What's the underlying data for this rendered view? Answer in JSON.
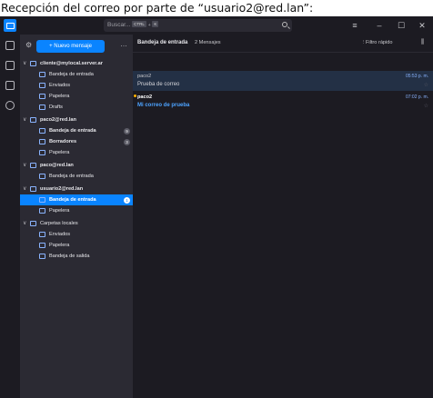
{
  "caption": "Recepción del correo por parte de “usuario2@red.lan”:",
  "titlebar": {
    "search_placeholder": "Buscar...",
    "search_kbd_1": "CTRL",
    "search_kbd_plus": "+",
    "search_kbd_2": "K",
    "menu_glyph": "≡",
    "min_glyph": "–",
    "max_glyph": "☐",
    "close_glyph": "✕"
  },
  "pane": {
    "new_message": "+ Nuevo mensaje",
    "more": "…"
  },
  "folders": [
    {
      "label": "cliente@mylocal.server.ar",
      "level": 0,
      "chevron": "∨",
      "bold": true,
      "icon": "account-icon"
    },
    {
      "label": "Bandeja de entrada",
      "level": 1,
      "icon": "inbox-icon"
    },
    {
      "label": "Enviados",
      "level": 1,
      "icon": "sent-icon"
    },
    {
      "label": "Papelera",
      "level": 1,
      "icon": "trash-icon"
    },
    {
      "label": "Drafts",
      "level": 1,
      "icon": "folder-icon"
    },
    {
      "label": "paco2@red.lan",
      "level": 0,
      "chevron": "∨",
      "bold": true,
      "icon": "account-icon"
    },
    {
      "label": "Bandeja de entrada",
      "level": 1,
      "bold": true,
      "icon": "inbox-icon",
      "badge": "9"
    },
    {
      "label": "Borradores",
      "level": 1,
      "bold": true,
      "icon": "drafts-icon",
      "badge": "3"
    },
    {
      "label": "Papelera",
      "level": 1,
      "icon": "trash-icon"
    },
    {
      "label": "paco@red.lan",
      "level": 0,
      "chevron": "∨",
      "bold": true,
      "icon": "account-icon"
    },
    {
      "label": "Bandeja de entrada",
      "level": 1,
      "icon": "inbox-icon"
    },
    {
      "label": "usuario2@red.lan",
      "level": 0,
      "chevron": "∨",
      "bold": true,
      "icon": "account-icon"
    },
    {
      "label": "Bandeja de entrada",
      "level": 1,
      "bold": true,
      "icon": "inbox-icon",
      "badge": "1",
      "selected": true
    },
    {
      "label": "Papelera",
      "level": 1,
      "icon": "trash-icon"
    },
    {
      "label": "Carpetas locales",
      "level": 0,
      "chevron": "∨",
      "bold": false,
      "icon": "local-folders-icon"
    },
    {
      "label": "Enviados",
      "level": 1,
      "icon": "sent-icon"
    },
    {
      "label": "Papelera",
      "level": 1,
      "icon": "trash-icon"
    },
    {
      "label": "Bandeja de salida",
      "level": 1,
      "icon": "outbox-icon"
    }
  ],
  "list": {
    "title": "Bandeja de entrada",
    "count": "2 Mensajes",
    "filter": "Filtro rápido",
    "filter_icon": "⫶",
    "options_icon": "⫼"
  },
  "messages": [
    {
      "from": "paco2",
      "subject": "Prueba de correo",
      "time": "05:53 p. m.",
      "star": "☆"
    },
    {
      "from": "paco2",
      "subject": "Mi correo de prueba",
      "time": "07:02 p. m.",
      "star": "☆"
    }
  ],
  "colors": {
    "accent": "#0a84ff",
    "background": "#1c1b22",
    "pane": "#2b2a33",
    "unread_dot": "#ffb000"
  }
}
